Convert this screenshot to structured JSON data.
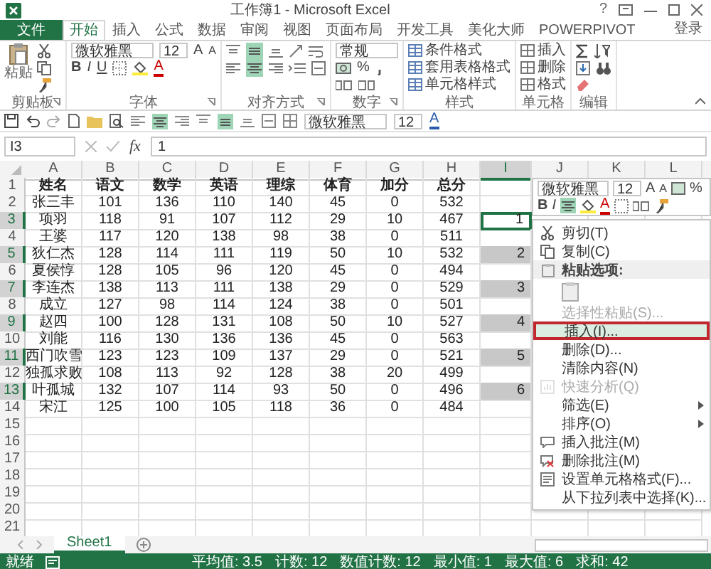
{
  "title": "工作簿1 - Microsoft Excel",
  "help": "?",
  "ribbon_tabs": [
    {
      "label": "文件",
      "kind": "file",
      "selected": false
    },
    {
      "label": "开始",
      "kind": "tab",
      "selected": true
    },
    {
      "label": "插入",
      "kind": "tab",
      "selected": false
    },
    {
      "label": "公式",
      "kind": "tab",
      "selected": false
    },
    {
      "label": "数据",
      "kind": "tab",
      "selected": false
    },
    {
      "label": "审阅",
      "kind": "tab",
      "selected": false
    },
    {
      "label": "视图",
      "kind": "tab",
      "selected": false
    },
    {
      "label": "页面布局",
      "kind": "tab",
      "selected": false
    },
    {
      "label": "开发工具",
      "kind": "tab",
      "selected": false
    },
    {
      "label": "美化大师",
      "kind": "tab",
      "selected": false
    },
    {
      "label": "POWERPIVOT",
      "kind": "tab",
      "selected": false
    }
  ],
  "sign_in": "登录",
  "ribbon": {
    "clipboard": {
      "paste": "粘贴",
      "label": "剪贴板"
    },
    "font": {
      "name": "微软雅黑",
      "size": "12",
      "grow": "A",
      "shrink": "A",
      "bold": "B",
      "italic": "I",
      "underline": "U",
      "font_color_button": "A",
      "label": "字体"
    },
    "alignment": {
      "label": "对齐方式"
    },
    "number": {
      "format": "常规",
      "percent": "%",
      "label": "数字"
    },
    "styles": {
      "items": [
        "条件格式",
        "套用表格格式",
        "单元格样式"
      ],
      "label": "样式"
    },
    "cells": {
      "items": [
        "插入",
        "删除",
        "格式"
      ],
      "label": "单元格"
    },
    "editing": {
      "label": "编辑"
    }
  },
  "quick_access": {
    "font": "微软雅黑",
    "size": "12",
    "font_color_button": "A"
  },
  "formula_bar": {
    "name_box": "I3",
    "fx": "fx",
    "value": "1"
  },
  "columns": [
    {
      "label": "A",
      "selected": false
    },
    {
      "label": "B",
      "selected": false
    },
    {
      "label": "C",
      "selected": false
    },
    {
      "label": "D",
      "selected": false
    },
    {
      "label": "E",
      "selected": false
    },
    {
      "label": "F",
      "selected": false
    },
    {
      "label": "G",
      "selected": false
    },
    {
      "label": "H",
      "selected": false
    },
    {
      "label": "I",
      "selected": true
    },
    {
      "label": "J",
      "selected": false
    },
    {
      "label": "K",
      "selected": false
    },
    {
      "label": "L",
      "selected": false
    }
  ],
  "rows": [
    {
      "number": "1",
      "kind": "header",
      "selected": false,
      "cells": [
        "姓名",
        "语文",
        "数学",
        "英语",
        "理综",
        "体育",
        "加分",
        "总分"
      ]
    },
    {
      "number": "2",
      "kind": "data",
      "selected": false,
      "cells": [
        "张三丰",
        "101",
        "136",
        "110",
        "140",
        "45",
        "0",
        "532"
      ]
    },
    {
      "number": "3",
      "kind": "data",
      "selected": true,
      "cells": [
        "项羽",
        "118",
        "91",
        "107",
        "112",
        "29",
        "10",
        "467"
      ],
      "i_cell": {
        "value": "1",
        "active": true
      }
    },
    {
      "number": "4",
      "kind": "data",
      "selected": false,
      "cells": [
        "王婆",
        "117",
        "120",
        "138",
        "98",
        "38",
        "0",
        "511"
      ]
    },
    {
      "number": "5",
      "kind": "data",
      "selected": true,
      "cells": [
        "狄仁杰",
        "128",
        "114",
        "111",
        "119",
        "50",
        "10",
        "532"
      ],
      "i_cell": {
        "value": "2",
        "active": false
      }
    },
    {
      "number": "6",
      "kind": "data",
      "selected": false,
      "cells": [
        "夏侯惇",
        "128",
        "105",
        "96",
        "120",
        "45",
        "0",
        "494"
      ]
    },
    {
      "number": "7",
      "kind": "data",
      "selected": true,
      "cells": [
        "李连杰",
        "138",
        "113",
        "111",
        "138",
        "29",
        "0",
        "529"
      ],
      "i_cell": {
        "value": "3",
        "active": false
      }
    },
    {
      "number": "8",
      "kind": "data",
      "selected": false,
      "cells": [
        "成立",
        "127",
        "98",
        "114",
        "124",
        "38",
        "0",
        "501"
      ]
    },
    {
      "number": "9",
      "kind": "data",
      "selected": true,
      "cells": [
        "赵四",
        "100",
        "128",
        "131",
        "108",
        "50",
        "10",
        "527"
      ],
      "i_cell": {
        "value": "4",
        "active": false
      }
    },
    {
      "number": "10",
      "kind": "data",
      "selected": false,
      "cells": [
        "刘能",
        "116",
        "130",
        "136",
        "136",
        "45",
        "0",
        "563"
      ]
    },
    {
      "number": "11",
      "kind": "data",
      "selected": true,
      "cells": [
        "西门吹雪",
        "123",
        "123",
        "109",
        "137",
        "29",
        "0",
        "521"
      ],
      "i_cell": {
        "value": "5",
        "active": false
      }
    },
    {
      "number": "12",
      "kind": "data",
      "selected": false,
      "cells": [
        "独孤求败",
        "108",
        "113",
        "92",
        "128",
        "38",
        "20",
        "499"
      ]
    },
    {
      "number": "13",
      "kind": "data",
      "selected": true,
      "cells": [
        "叶孤城",
        "132",
        "107",
        "114",
        "93",
        "50",
        "0",
        "496"
      ],
      "i_cell": {
        "value": "6",
        "active": false
      }
    },
    {
      "number": "14",
      "kind": "data",
      "selected": false,
      "cells": [
        "宋江",
        "125",
        "100",
        "105",
        "118",
        "36",
        "0",
        "484"
      ]
    },
    {
      "number": "15",
      "selected": false
    },
    {
      "number": "16",
      "selected": false
    },
    {
      "number": "17",
      "selected": false
    },
    {
      "number": "18",
      "selected": false
    },
    {
      "number": "19",
      "selected": false
    },
    {
      "number": "20",
      "selected": false
    },
    {
      "number": "21",
      "selected": false
    }
  ],
  "mini_toolbar": {
    "font": "微软雅黑",
    "size": "12",
    "grow": "A",
    "shrink": "A",
    "percent": "%",
    "bold": "B",
    "italic": "I",
    "font_color_button": "A"
  },
  "context_menu": [
    {
      "label": "剪切(T)",
      "kind": "item",
      "disabled": false,
      "selected": false
    },
    {
      "label": "复制(C)",
      "kind": "item",
      "disabled": false,
      "selected": false
    },
    {
      "label": "粘贴选项:",
      "kind": "heading",
      "disabled": false,
      "selected": false
    },
    {
      "kind": "paste-icons",
      "disabled": false,
      "selected": false
    },
    {
      "label": "选择性粘贴(S)...",
      "kind": "item",
      "disabled": true,
      "selected": false
    },
    {
      "label": "插入(I)...",
      "kind": "item",
      "disabled": false,
      "selected": true
    },
    {
      "label": "删除(D)...",
      "kind": "item",
      "disabled": false,
      "selected": false
    },
    {
      "label": "清除内容(N)",
      "kind": "item",
      "disabled": false,
      "selected": false
    },
    {
      "label": "快速分析(Q)",
      "kind": "item",
      "disabled": true,
      "selected": false
    },
    {
      "label": "筛选(E)",
      "kind": "submenu",
      "disabled": false,
      "selected": false
    },
    {
      "label": "排序(O)",
      "kind": "submenu",
      "disabled": false,
      "selected": false
    },
    {
      "label": "插入批注(M)",
      "kind": "item",
      "disabled": false,
      "selected": false
    },
    {
      "label": "删除批注(M)",
      "kind": "item",
      "disabled": false,
      "selected": false
    },
    {
      "label": "设置单元格格式(F)...",
      "kind": "item",
      "disabled": false,
      "selected": false
    },
    {
      "label": "从下拉列表中选择(K)...",
      "kind": "item",
      "disabled": false,
      "selected": false
    }
  ],
  "sheet_tabs": [
    {
      "label": "Sheet1",
      "selected": true
    }
  ],
  "status_bar": {
    "ready": "就绪",
    "stats": [
      "平均值: 3.5",
      "计数: 12",
      "数值计数: 12",
      "最小值: 1",
      "最大值: 6",
      "求和: 42"
    ]
  }
}
